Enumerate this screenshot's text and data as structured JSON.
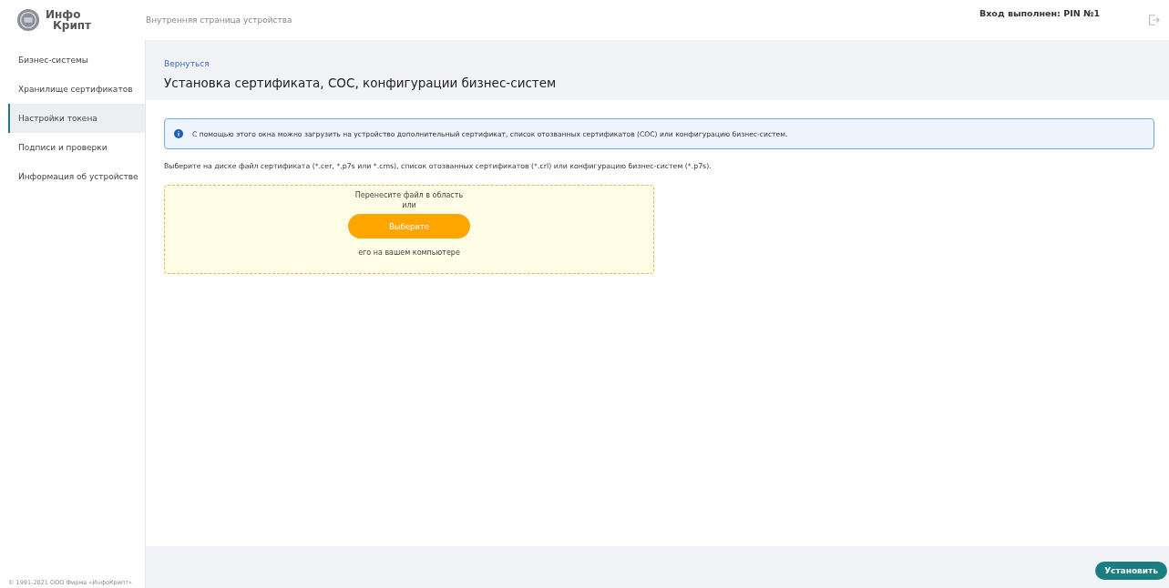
{
  "logo": {
    "line_1": "Инфо",
    "line_2": "Крипт"
  },
  "header": {
    "page_title": "Внутренняя страница устройства",
    "login_status": "Вход выполнен: PIN №1"
  },
  "sidebar": {
    "items": [
      {
        "label": "Бизнес-системы",
        "selected": false
      },
      {
        "label": "Хранилище сертификатов",
        "selected": false
      },
      {
        "label": "Настройки токена",
        "selected": true
      },
      {
        "label": "Подписи и проверки",
        "selected": false
      },
      {
        "label": "Информация об устройстве",
        "selected": false
      }
    ],
    "copyright": "© 1991-2021 ООО Фирма «ИнфоКрипт»"
  },
  "content": {
    "back_link": "Вернуться",
    "title": "Установка сертификата, СОС, конфигурации бизнес-систем",
    "info": "С помощью этого окна можно загрузить на устройство дополнительный сертификат, список отозванных сертификатов (СОС) или конфигурацию бизнес-систем.",
    "instructions": "Выберите на диске файл сертификата (*.cer, *.p7s или *.cms), список отозванных сертификатов (*.crl) или конфигурацию бизнес-систем (*.p7s).",
    "dropzone": {
      "line_1": "Перенесите файл в область",
      "line_2": "или",
      "button": "Выберите",
      "line_3": "его на вашем компьютере"
    }
  },
  "footer": {
    "button": "Установить"
  }
}
